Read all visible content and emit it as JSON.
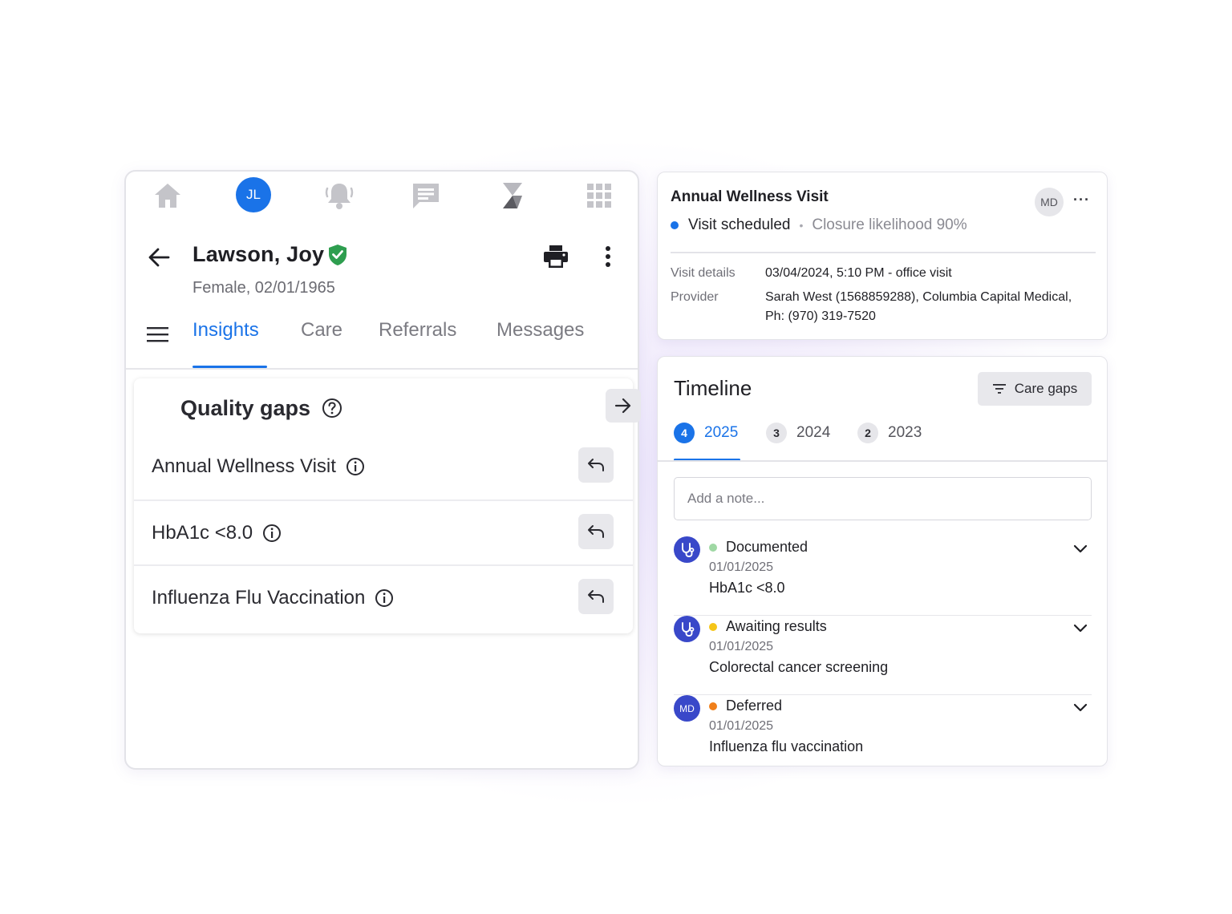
{
  "colors": {
    "accent": "#1a73e8",
    "verified": "#2e9e4f",
    "timeline_avatar": "#3948c9",
    "status_documented": "#9fd8a4",
    "status_awaiting": "#f5c518",
    "status_deferred": "#f07f1a"
  },
  "topnav": {
    "icons": [
      "home-icon",
      "notification-bell-icon",
      "chat-icon",
      "app-logo-icon",
      "apps-grid-icon"
    ],
    "avatar_initials": "JL"
  },
  "patient": {
    "name": "Lawson, Joy",
    "sub": "Female, 02/01/1965"
  },
  "tabs": [
    {
      "label": "Insights",
      "active": true
    },
    {
      "label": "Care",
      "active": false
    },
    {
      "label": "Referrals",
      "active": false
    },
    {
      "label": "Messages",
      "active": false
    }
  ],
  "quality_gaps": {
    "title": "Quality gaps",
    "items": [
      {
        "label": "Annual Wellness Visit"
      },
      {
        "label": "HbA1c <8.0"
      },
      {
        "label": "Influenza Flu Vaccination"
      }
    ]
  },
  "visit_card": {
    "title": "Annual Wellness Visit",
    "avatar_initials": "MD",
    "more": "···",
    "status": "Visit scheduled",
    "sep": "•",
    "closure": "Closure likelihood 90%",
    "details": [
      {
        "label": "Visit details",
        "value": "03/04/2024, 5:10 PM - office visit"
      },
      {
        "label": "Provider",
        "value": "Sarah West (1568859288), Columbia Capital Medical, Ph: (970) 319-7520"
      }
    ]
  },
  "timeline": {
    "title": "Timeline",
    "filter_label": "Care gaps",
    "years": [
      {
        "count": "4",
        "year": "2025",
        "active": true
      },
      {
        "count": "3",
        "year": "2024",
        "active": false
      },
      {
        "count": "2",
        "year": "2023",
        "active": false
      }
    ],
    "note_placeholder": "Add a note...",
    "items": [
      {
        "avatar": "stethoscope-icon",
        "status": "Documented",
        "date": "01/01/2025",
        "description": "HbA1c <8.0"
      },
      {
        "avatar": "stethoscope-icon",
        "status": "Awaiting results",
        "date": "01/01/2025",
        "description": "Colorectal cancer screening"
      },
      {
        "avatar_initials": "MD",
        "status": "Deferred",
        "date": "01/01/2025",
        "description": "Influenza flu vaccination"
      }
    ]
  }
}
